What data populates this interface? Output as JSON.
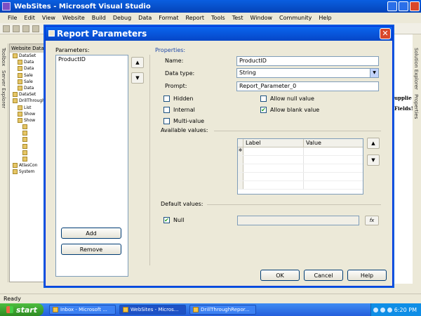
{
  "window": {
    "title": "WebSites - Microsoft Visual Studio"
  },
  "menu": [
    "File",
    "Edit",
    "View",
    "Website",
    "Build",
    "Debug",
    "Data",
    "Format",
    "Report",
    "Tools",
    "Test",
    "Window",
    "Community",
    "Help"
  ],
  "left_tabs": {
    "toolbox": "Toolbox",
    "server_explorer": "Server Explorer"
  },
  "right_tabs": {
    "solution_explorer": "Solution Explorer",
    "properties": "Properties"
  },
  "solution_panel": {
    "header": "Website Data",
    "items": [
      "DataSet",
      "Data",
      "Data",
      "Sale",
      "Sale",
      "Data",
      "DataSet",
      "DrillThrough",
      "List",
      "Show",
      "Show",
      "",
      "",
      "",
      "",
      "",
      "",
      "AtlasCon",
      "System"
    ]
  },
  "right_panel_text": {
    "suppliers": "upplie",
    "fields": "Fields!"
  },
  "status": {
    "text": "Ready"
  },
  "taskbar": {
    "start_label": "start",
    "items": [
      "Inbox - Microsoft ...",
      "WebSites - Micros...",
      "DrillThroughRepor..."
    ],
    "clock": "6:20 PM"
  },
  "dialog": {
    "title": "Report Parameters",
    "parameters_label": "Parameters:",
    "parameters": [
      "ProductID"
    ],
    "add_label": "Add",
    "remove_label": "Remove",
    "properties_label": "Properties:",
    "name_label": "Name:",
    "name_value": "ProductID",
    "datatype_label": "Data type:",
    "datatype_value": "String",
    "prompt_label": "Prompt:",
    "prompt_value": "Report_Parameter_0",
    "hidden_label": "Hidden",
    "internal_label": "Internal",
    "multivalue_label": "Multi-value",
    "allownull_label": "Allow null value",
    "allowblank_label": "Allow blank value",
    "available_values_label": "Available values:",
    "grid_col_label": "Label",
    "grid_col_value": "Value",
    "default_values_label": "Default values:",
    "null_label": "Null",
    "fx_label": "fx",
    "ok_label": "OK",
    "cancel_label": "Cancel",
    "help_label": "Help"
  }
}
